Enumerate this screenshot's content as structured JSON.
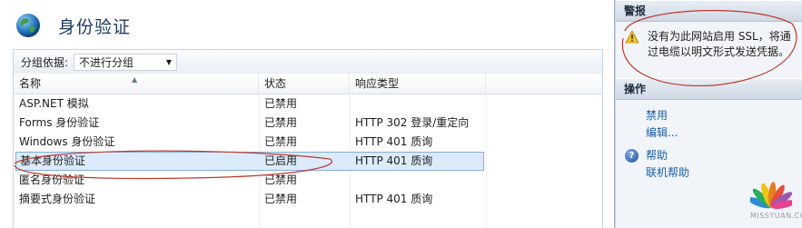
{
  "page": {
    "title": "身份验证"
  },
  "group_bar": {
    "label": "分组依据:",
    "selected": "不进行分组"
  },
  "grid": {
    "columns": [
      "名称",
      "状态",
      "响应类型"
    ],
    "rows": [
      {
        "name": "ASP.NET 模拟",
        "status": "已禁用",
        "response": ""
      },
      {
        "name": "Forms 身份验证",
        "status": "已禁用",
        "response": "HTTP 302 登录/重定向"
      },
      {
        "name": "Windows 身份验证",
        "status": "已禁用",
        "response": "HTTP 401 质询"
      },
      {
        "name": "基本身份验证",
        "status": "已启用",
        "response": "HTTP 401 质询"
      },
      {
        "name": "匿名身份验证",
        "status": "已禁用",
        "response": ""
      },
      {
        "name": "摘要式身份验证",
        "status": "已禁用",
        "response": "HTTP 401 质询"
      }
    ],
    "selected_row_index": 3
  },
  "actions": {
    "alerts_header": "警报",
    "alert_text": "没有为此网站启用 SSL，将通过电缆以明文形式发送凭据。",
    "actions_header": "操作",
    "disable": "禁用",
    "edit": "编辑...",
    "help": "帮助",
    "online_help": "联机帮助"
  },
  "watermark": {
    "text": "MISSYUAN.COM"
  },
  "colors": {
    "accent": "#1a5fa8",
    "annotation": "#c0392b",
    "selection": "#dcebfc"
  },
  "icons": {
    "page": "globe-icon",
    "alert": "warning-icon",
    "help": "help-icon"
  }
}
